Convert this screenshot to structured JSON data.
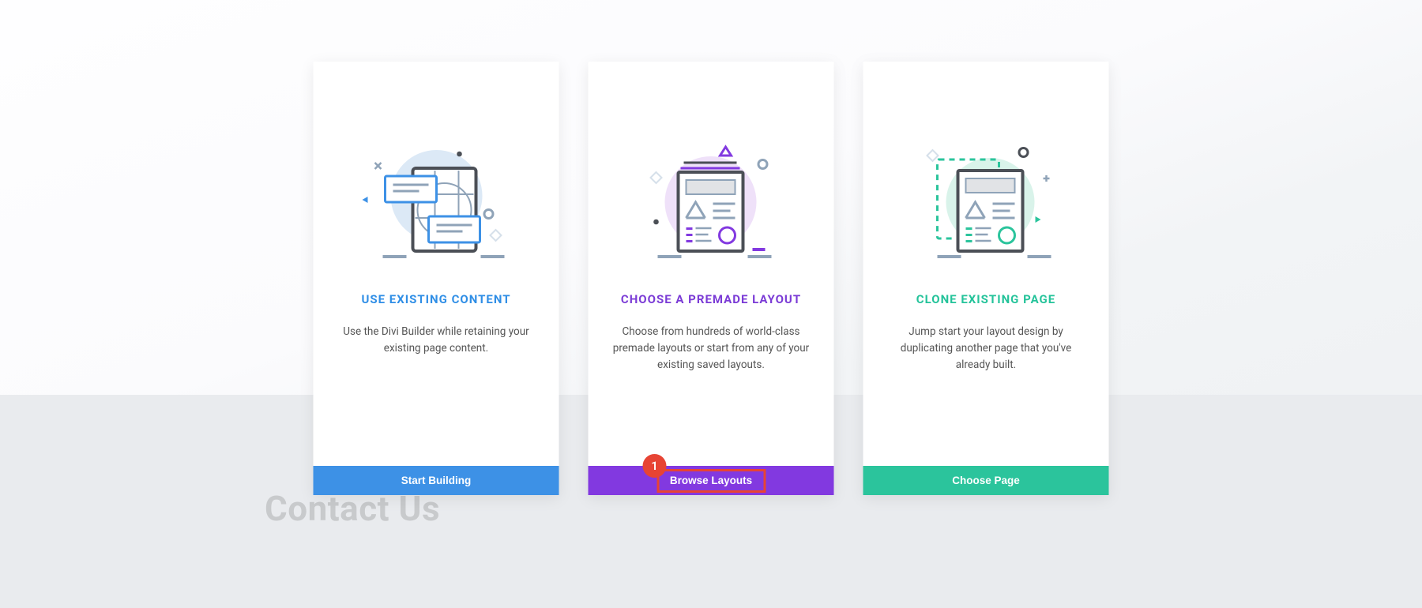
{
  "background": {
    "watermark": "Contact Us"
  },
  "cards": [
    {
      "title": "USE EXISTING CONTENT",
      "desc": "Use the Divi Builder while retaining your existing page content.",
      "button": "Start Building"
    },
    {
      "title": "CHOOSE A PREMADE LAYOUT",
      "desc": "Choose from hundreds of world-class premade layouts or start from any of your existing saved layouts.",
      "button": "Browse Layouts"
    },
    {
      "title": "CLONE EXISTING PAGE",
      "desc": "Jump start your layout design by duplicating another page that you've already built.",
      "button": "Choose Page"
    }
  ],
  "annotation": {
    "number": "1"
  }
}
